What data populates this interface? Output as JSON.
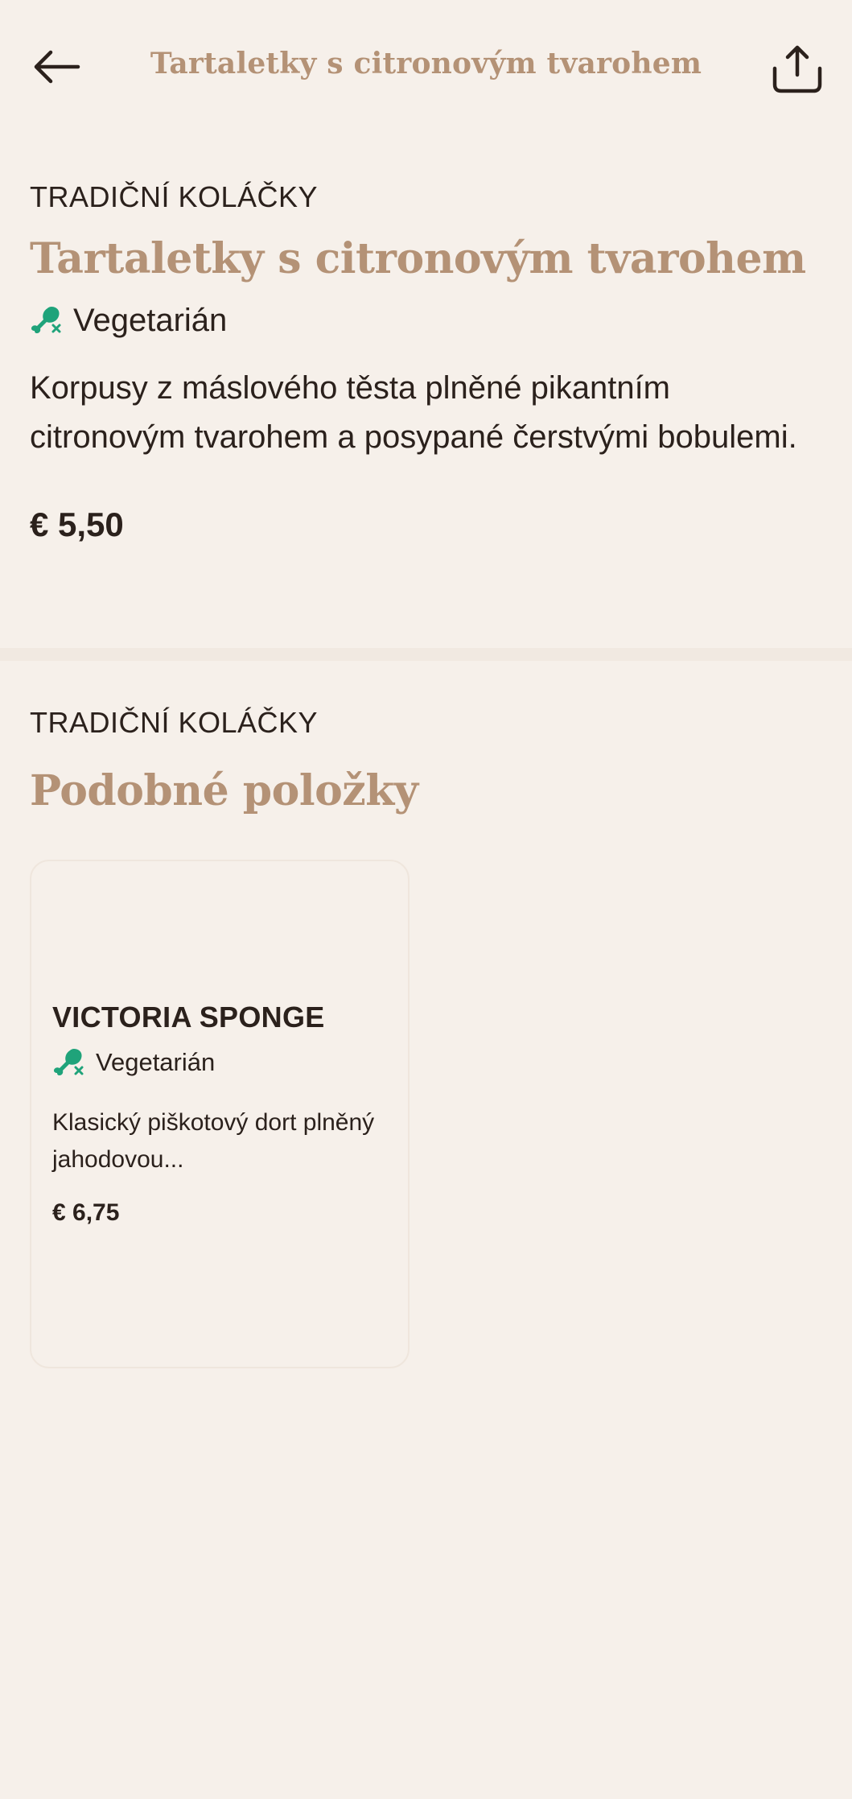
{
  "header": {
    "title": "Tartaletky s citronovým tvarohem"
  },
  "product": {
    "category": "TRADIČNÍ KOLÁČKY",
    "name": "Tartaletky s citronovým tvarohem",
    "diet_label": "Vegetarián",
    "diet_icon": "vegetarian-drumstick-icon",
    "description": "Korpusy z máslového těsta plněné pikantním citronovým tvarohem a posypané čerstvými bobulemi.",
    "price": "€ 5,50"
  },
  "similar": {
    "category": "TRADIČNÍ KOLÁČKY",
    "title": "Podobné položky",
    "items": [
      {
        "name": "VICTORIA SPONGE",
        "diet_label": "Vegetarián",
        "description": "Klasický piškotový dort plněný jahodovou...",
        "price": "€ 6,75"
      }
    ]
  },
  "colors": {
    "background": "#f6f0ea",
    "accent": "#b49276",
    "text": "#2b211c",
    "diet_green": "#1fa37a"
  }
}
